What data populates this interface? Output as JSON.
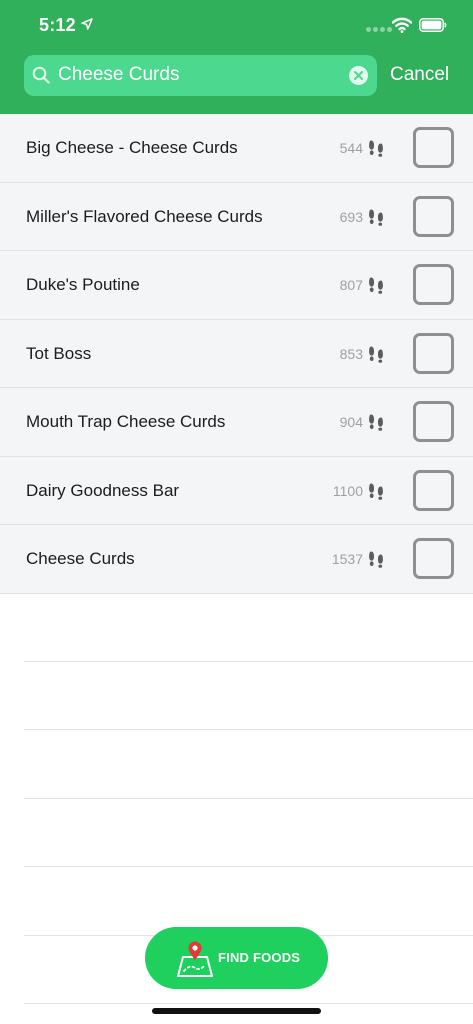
{
  "status_bar": {
    "time": "5:12"
  },
  "search": {
    "query": "Cheese Curds",
    "cancel_label": "Cancel"
  },
  "foods": [
    {
      "name": "Big Cheese - Cheese Curds",
      "value": "544",
      "checked": false
    },
    {
      "name": "Miller's Flavored Cheese Curds",
      "value": "693",
      "checked": false
    },
    {
      "name": "Duke's Poutine",
      "value": "807",
      "checked": false
    },
    {
      "name": "Tot Boss",
      "value": "853",
      "checked": false
    },
    {
      "name": "Mouth Trap Cheese Curds",
      "value": "904",
      "checked": false
    },
    {
      "name": "Dairy Goodness Bar",
      "value": "1100",
      "checked": false
    },
    {
      "name": "Cheese Curds",
      "value": "1537",
      "checked": false
    }
  ],
  "find_button": {
    "label": "FIND FOODS"
  },
  "icons": {
    "location": "location-arrow-icon",
    "wifi": "wifi-icon",
    "battery": "battery-icon",
    "search": "search-icon",
    "clear": "clear-icon",
    "steps": "footprints-icon",
    "map": "map-pin-icon"
  },
  "colors": {
    "header": "#30b05b",
    "search_field": "#4cd88e",
    "find_button": "#1fd05e",
    "pin": "#e53935"
  }
}
